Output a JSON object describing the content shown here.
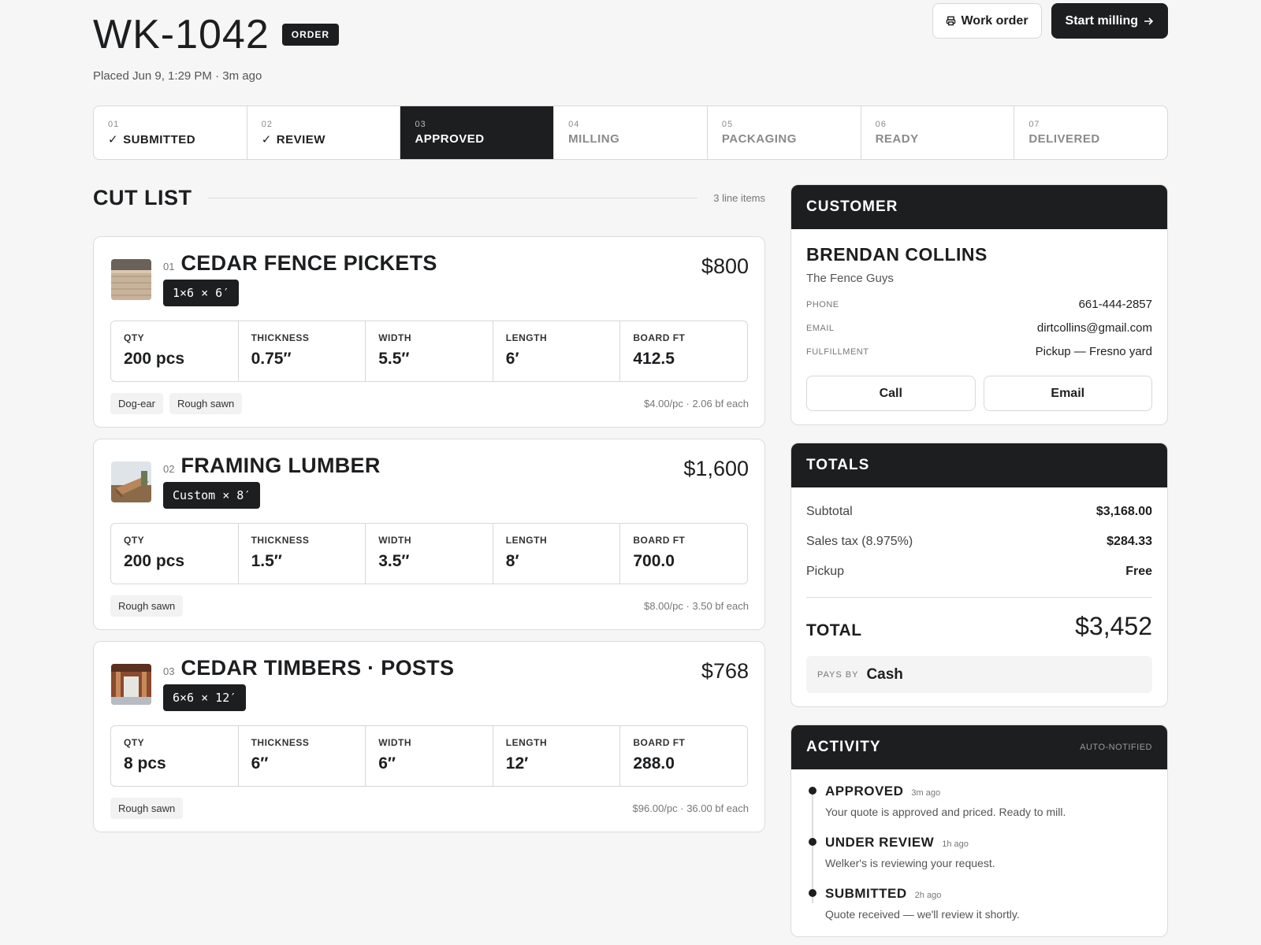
{
  "order": {
    "id": "WK-1042",
    "badge": "ORDER",
    "placed": "Placed Jun 9, 1:29 PM · 3m ago"
  },
  "actions": {
    "work_order": "Work order",
    "start_milling": "Start milling",
    "work_order_icon": "printer-icon",
    "start_icon": "arrow-right-icon"
  },
  "steps": [
    {
      "num": "01",
      "label": "SUBMITTED",
      "status": "done"
    },
    {
      "num": "02",
      "label": "REVIEW",
      "status": "done"
    },
    {
      "num": "03",
      "label": "APPROVED",
      "status": "active"
    },
    {
      "num": "04",
      "label": "MILLING",
      "status": "pending"
    },
    {
      "num": "05",
      "label": "PACKAGING",
      "status": "pending"
    },
    {
      "num": "06",
      "label": "READY",
      "status": "pending"
    },
    {
      "num": "07",
      "label": "DELIVERED",
      "status": "pending"
    }
  ],
  "cut_list": {
    "title": "CUT LIST",
    "count": "3 line items",
    "spec_labels": {
      "qty": "QTY",
      "thickness": "THICKNESS",
      "width": "WIDTH",
      "length": "LENGTH",
      "board_ft": "BOARD FT"
    },
    "items": [
      {
        "num": "01",
        "name": "CEDAR FENCE PICKETS",
        "dims": "1×6 × 6′",
        "price": "$800",
        "qty": "200 pcs",
        "thickness": "0.75″",
        "width": "5.5″",
        "length": "6′",
        "board_ft": "412.5",
        "tags": [
          "Dog-ear",
          "Rough sawn"
        ],
        "unit": "$4.00/pc · 2.06 bf each"
      },
      {
        "num": "02",
        "name": "FRAMING LUMBER",
        "dims": "Custom × 8′",
        "price": "$1,600",
        "qty": "200 pcs",
        "thickness": "1.5″",
        "width": "3.5″",
        "length": "8′",
        "board_ft": "700.0",
        "tags": [
          "Rough sawn"
        ],
        "unit": "$8.00/pc · 3.50 bf each"
      },
      {
        "num": "03",
        "name": "CEDAR TIMBERS · POSTS",
        "dims": "6×6 × 12′",
        "price": "$768",
        "qty": "8 pcs",
        "thickness": "6″",
        "width": "6″",
        "length": "12′",
        "board_ft": "288.0",
        "tags": [
          "Rough sawn"
        ],
        "unit": "$96.00/pc · 36.00 bf each"
      }
    ]
  },
  "customer": {
    "header": "CUSTOMER",
    "name": "BRENDAN COLLINS",
    "company": "The Fence Guys",
    "phone_label": "PHONE",
    "phone": "661-444-2857",
    "email_label": "EMAIL",
    "email": "dirtcollins@gmail.com",
    "fulfillment_label": "FULFILLMENT",
    "fulfillment": "Pickup — Fresno yard",
    "call_label": "Call",
    "email_button": "Email"
  },
  "totals": {
    "header": "TOTALS",
    "subtotal_label": "Subtotal",
    "subtotal": "$3,168.00",
    "tax_label": "Sales tax (8.975%)",
    "tax": "$284.33",
    "pickup_label": "Pickup",
    "pickup": "Free",
    "total_label": "TOTAL",
    "total": "$3,452",
    "pays_by_label": "PAYS BY",
    "pays_by": "Cash"
  },
  "activity": {
    "header": "ACTIVITY",
    "note": "AUTO-NOTIFIED",
    "events": [
      {
        "title": "APPROVED",
        "ago": "3m ago",
        "desc": "Your quote is approved and priced. Ready to mill."
      },
      {
        "title": "UNDER REVIEW",
        "ago": "1h ago",
        "desc": "Welker's is reviewing your request."
      },
      {
        "title": "SUBMITTED",
        "ago": "2h ago",
        "desc": "Quote received — we'll review it shortly."
      }
    ]
  }
}
